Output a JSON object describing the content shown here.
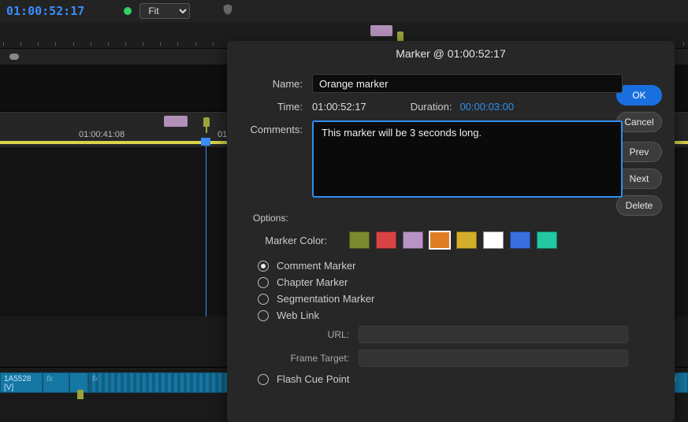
{
  "topbar": {
    "timecode": "01:00:52:17",
    "zoom_selected": "Fit"
  },
  "timeline": {
    "ruler_label_1": "01:00:41:08",
    "ruler_label_2": "01:"
  },
  "track": {
    "clip1_label": "1A5528 [V]",
    "fx": "fx"
  },
  "dialog": {
    "title": "Marker @ 01:00:52:17",
    "name_label": "Name:",
    "name_value": "Orange marker",
    "time_label": "Time:",
    "time_value": "01:00:52:17",
    "duration_label": "Duration:",
    "duration_value": "00:00:03:00",
    "comments_label": "Comments:",
    "comments_value": "This marker will be 3 seconds long.",
    "buttons": {
      "ok": "OK",
      "cancel": "Cancel",
      "prev": "Prev",
      "next": "Next",
      "delete": "Delete"
    },
    "options": {
      "header": "Options:",
      "color_label": "Marker Color:",
      "colors": [
        "#7a8a2e",
        "#d84444",
        "#b993c5",
        "#e07c22",
        "#d4ae2b",
        "#ffffff",
        "#3b6fe0",
        "#22c7a3"
      ],
      "selected_color_index": 3,
      "types": [
        "Comment Marker",
        "Chapter Marker",
        "Segmentation Marker",
        "Web Link"
      ],
      "selected_type_index": 0,
      "url_label": "URL:",
      "frame_target_label": "Frame Target:",
      "flash_label": "Flash Cue Point"
    }
  }
}
